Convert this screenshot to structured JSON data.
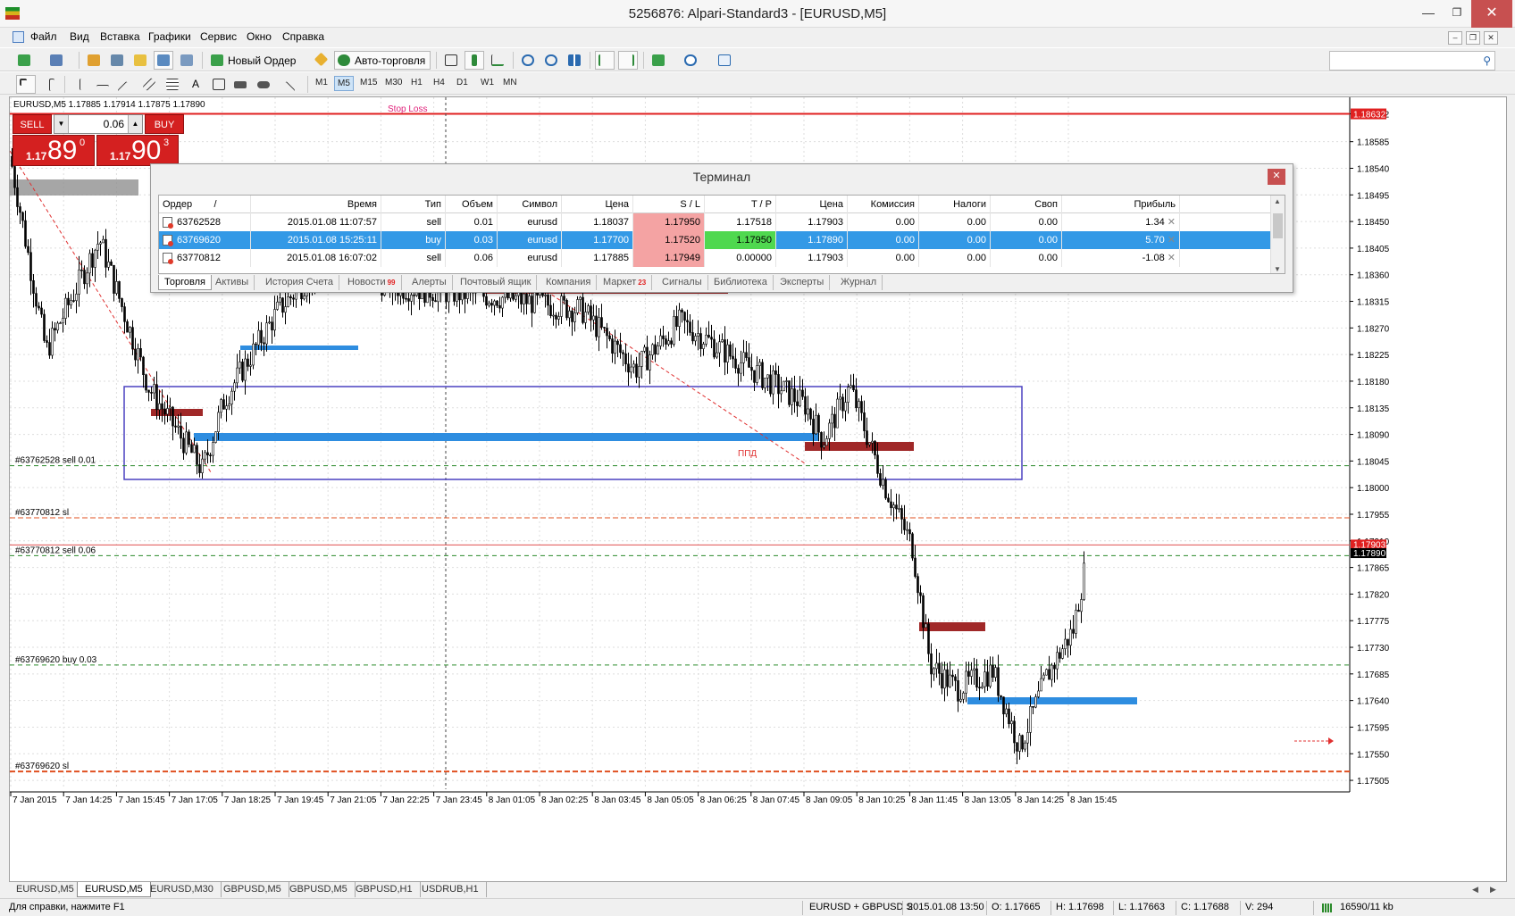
{
  "window": {
    "title": "5256876: Alpari-Standard3 - [EURUSD,M5]"
  },
  "menu": [
    "Файл",
    "Вид",
    "Вставка",
    "Графики",
    "Сервис",
    "Окно",
    "Справка"
  ],
  "toolbar": {
    "new_order": "Новый Ордер",
    "autotrading": "Авто-торговля"
  },
  "timeframes": [
    "M1",
    "M5",
    "M15",
    "M30",
    "H1",
    "H4",
    "D1",
    "W1",
    "MN"
  ],
  "selected_timeframe": "M5",
  "chart": {
    "header": "EURUSD,M5  1.17885 1.17914 1.17875 1.17890",
    "stop_loss_label": "Stop Loss",
    "ppd_label": "ППД",
    "price_ticks": [
      "1.18632",
      "1.18585",
      "1.18540",
      "1.18495",
      "1.18450",
      "1.18405",
      "1.18360",
      "1.18315",
      "1.18270",
      "1.18225",
      "1.18180",
      "1.18135",
      "1.18090",
      "1.18045",
      "1.18000",
      "1.17955",
      "1.17910",
      "1.17865",
      "1.17820",
      "1.17775",
      "1.17730",
      "1.17685",
      "1.17640",
      "1.17595",
      "1.17550",
      "1.17505"
    ],
    "highlight_prices": {
      "top_red": "1.18632",
      "current_red": "1.17903",
      "current_black": "1.17890"
    },
    "time_ticks": [
      "7 Jan 2015",
      "7 Jan 14:25",
      "7 Jan 15:45",
      "7 Jan 17:05",
      "7 Jan 18:25",
      "7 Jan 19:45",
      "7 Jan 21:05",
      "7 Jan 22:25",
      "7 Jan 23:45",
      "8 Jan 01:05",
      "8 Jan 02:25",
      "8 Jan 03:45",
      "8 Jan 05:05",
      "8 Jan 06:25",
      "8 Jan 07:45",
      "8 Jan 09:05",
      "8 Jan 10:25",
      "8 Jan 11:45",
      "8 Jan 13:05",
      "8 Jan 14:25",
      "8 Jan 15:45"
    ],
    "order_lines": [
      {
        "label": "#63762528 sell 0.01",
        "price": 1.18037,
        "color": "#2a8a2a"
      },
      {
        "label": "#63770812 sl",
        "price": 1.17949,
        "color": "#e05020"
      },
      {
        "label": "#63770812 sell 0.06",
        "price": 1.17885,
        "color": "#2a8a2a"
      },
      {
        "label": "#63769620 buy 0.03",
        "price": 1.177,
        "color": "#2a8a2a"
      },
      {
        "label": "#63769620 sl",
        "price": 1.1752,
        "color": "#e05020"
      }
    ]
  },
  "one_click": {
    "sell": "SELL",
    "buy": "BUY",
    "lot": "0.06",
    "bid_small": "1.17",
    "bid_big": "89",
    "bid_sup": "0",
    "ask_small": "1.17",
    "ask_big": "90",
    "ask_sup": "3"
  },
  "terminal": {
    "title": "Терминал",
    "columns": [
      "Ордер",
      "/",
      "Время",
      "Тип",
      "Объем",
      "Символ",
      "Цена",
      "S / L",
      "T / P",
      "Цена",
      "Комиссия",
      "Налоги",
      "Своп",
      "Прибыль"
    ],
    "rows": [
      {
        "order": "63762528",
        "time": "2015.01.08 11:07:57",
        "type": "sell",
        "volume": "0.01",
        "symbol": "eurusd",
        "price": "1.18037",
        "sl": "1.17950",
        "tp": "1.17518",
        "cur": "1.17903",
        "commission": "0.00",
        "taxes": "0.00",
        "swap": "0.00",
        "profit": "1.34"
      },
      {
        "order": "63769620",
        "time": "2015.01.08 15:25:11",
        "type": "buy",
        "volume": "0.03",
        "symbol": "eurusd",
        "price": "1.17700",
        "sl": "1.17520",
        "tp": "1.17950",
        "cur": "1.17890",
        "commission": "0.00",
        "taxes": "0.00",
        "swap": "0.00",
        "profit": "5.70"
      },
      {
        "order": "63770812",
        "time": "2015.01.08 16:07:02",
        "type": "sell",
        "volume": "0.06",
        "symbol": "eurusd",
        "price": "1.17885",
        "sl": "1.17949",
        "tp": "0.00000",
        "cur": "1.17903",
        "commission": "0.00",
        "taxes": "0.00",
        "swap": "0.00",
        "profit": "-1.08"
      }
    ],
    "tabs": [
      {
        "label": "Торговля",
        "badge": ""
      },
      {
        "label": "Активы",
        "badge": ""
      },
      {
        "label": "История Счета",
        "badge": ""
      },
      {
        "label": "Новости",
        "badge": "99"
      },
      {
        "label": "Алерты",
        "badge": ""
      },
      {
        "label": "Почтовый ящик",
        "badge": ""
      },
      {
        "label": "Компания",
        "badge": ""
      },
      {
        "label": "Маркет",
        "badge": "23"
      },
      {
        "label": "Сигналы",
        "badge": ""
      },
      {
        "label": "Библиотека",
        "badge": ""
      },
      {
        "label": "Эксперты",
        "badge": ""
      },
      {
        "label": "Журнал",
        "badge": ""
      }
    ]
  },
  "chart_tabs": [
    "EURUSD,M5",
    "EURUSD,M5",
    "EURUSD,M30",
    "GBPUSD,M5",
    "GBPUSD,M5",
    "GBPUSD,H1",
    "USDRUB,H1"
  ],
  "status": {
    "help": "Для справки, нажмите F1",
    "profile": "EURUSD + GBPUSD S",
    "datetime": "2015.01.08 13:50",
    "open": "O: 1.17665",
    "high": "H: 1.17698",
    "low": "L: 1.17663",
    "close": "C: 1.17688",
    "volume": "V: 294",
    "traffic": "16590/11 kb"
  }
}
